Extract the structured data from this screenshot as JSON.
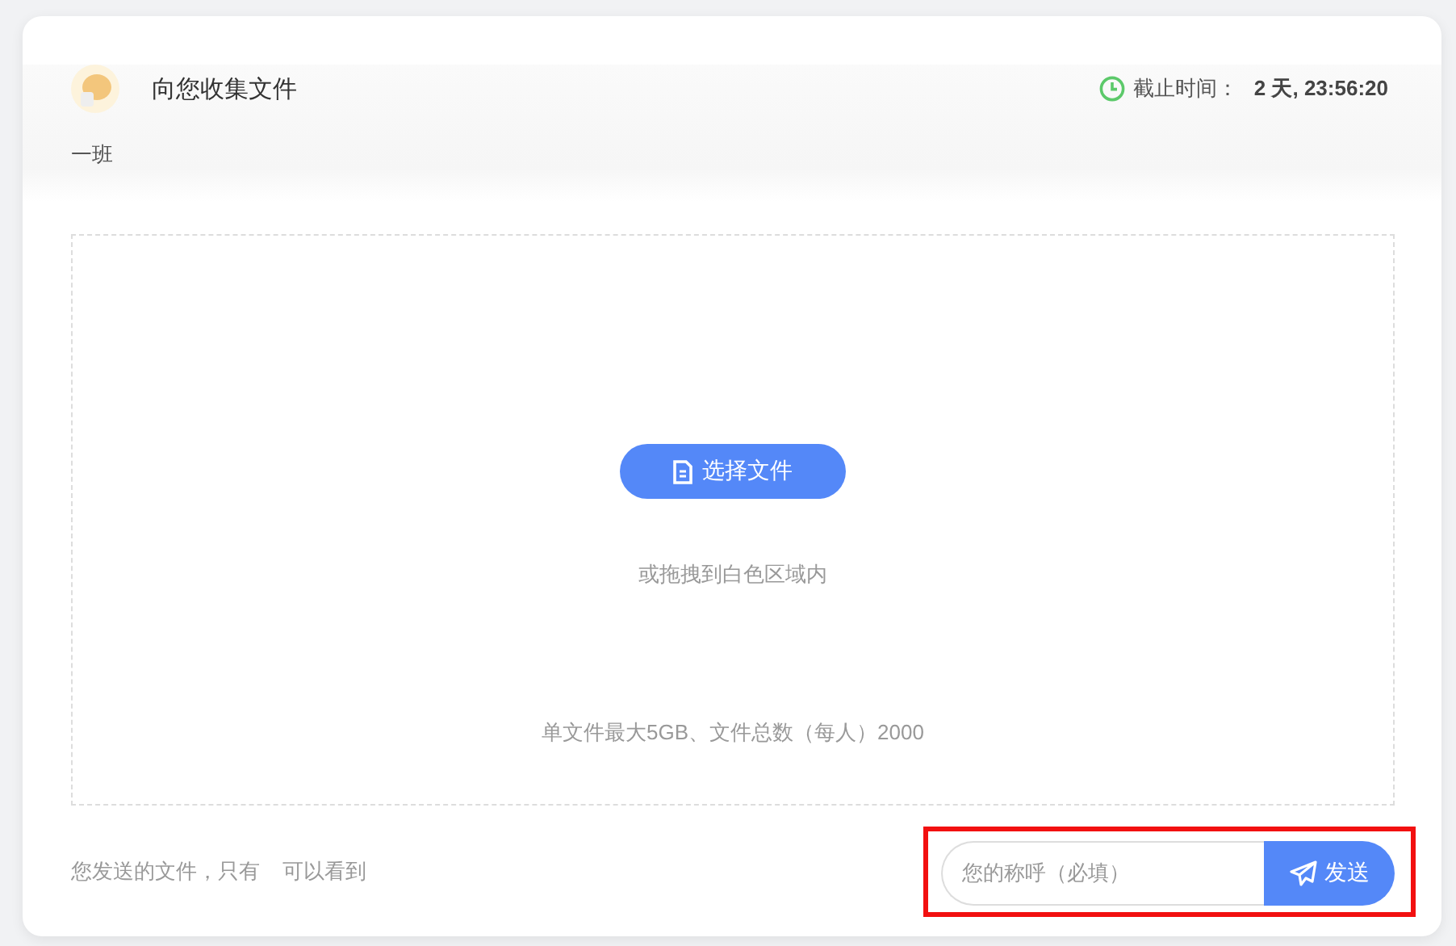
{
  "header": {
    "title": "向您收集文件",
    "deadline_label": "截止时间：",
    "deadline_value": "2 天, 23:56:20",
    "subtitle": "一班"
  },
  "dropzone": {
    "button": "选择文件",
    "hint": "或拖拽到白色区域内",
    "limits": "单文件最大5GB、文件总数（每人）2000"
  },
  "footer": {
    "notice_start": "您发送的文件，只有",
    "notice_end": "可以看到",
    "name_field": {
      "placeholder": "您的称呼（必填）"
    },
    "send_button": "发送",
    "highlighted": true
  }
}
